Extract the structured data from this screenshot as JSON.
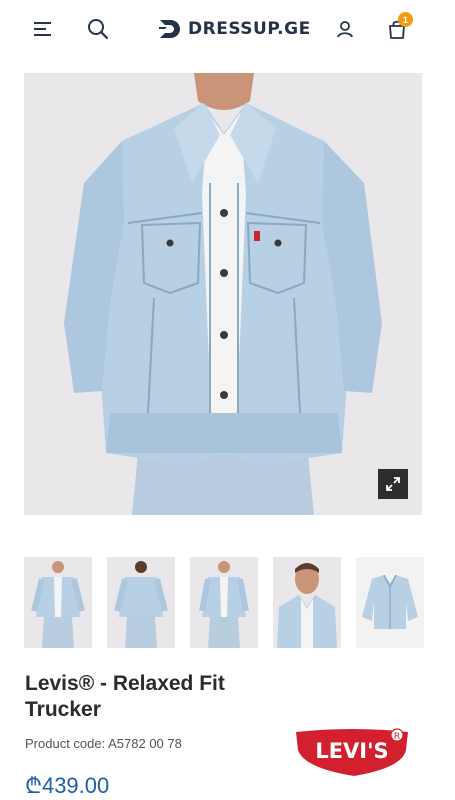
{
  "header": {
    "logo_text": "DRESSUP.GE",
    "cart_count": "1",
    "icons": [
      "menu-icon",
      "search-icon",
      "logo-icon",
      "user-icon",
      "shopping-bag-icon"
    ]
  },
  "gallery": {
    "thumbnail_count": 5,
    "expand_icon": "expand-icon"
  },
  "product": {
    "title": "Levis® - Relaxed Fit Trucker",
    "code": "Product code: A5782 00 78",
    "price": "₾439.00",
    "brand_logo_text": "LEVI'S",
    "price_color": "#1d5fa8",
    "brand_color": "#d3202e"
  }
}
